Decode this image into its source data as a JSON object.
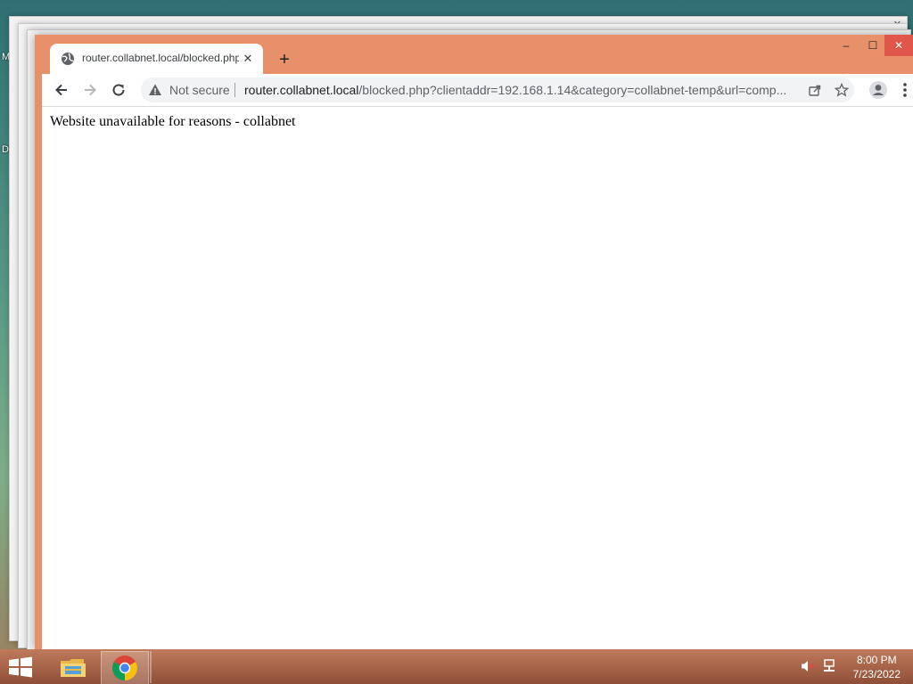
{
  "desktop": {
    "icon_labels": [
      "M",
      "D"
    ]
  },
  "browser": {
    "tab": {
      "title": "router.collabnet.local/blocked.php",
      "favicon": "globe-icon",
      "close_glyph": "✕"
    },
    "new_tab_glyph": "+",
    "window_controls": {
      "minimize": "–",
      "maximize": "☐",
      "close": "✕"
    },
    "toolbar": {
      "back_icon": "back-arrow-icon",
      "forward_icon": "forward-arrow-icon",
      "reload_icon": "reload-icon"
    },
    "omnibox": {
      "security_label": "Not secure",
      "url_host": "router.collabnet.local",
      "url_path": "/blocked.php?clientaddr=192.168.1.14&category=collabnet-temp&url=comp..."
    },
    "accent_color": "#e8906a",
    "close_color": "#e0564a"
  },
  "page": {
    "body_text": "Website unavailable for reasons - collabnet"
  },
  "taskbar": {
    "apps": [
      "file-explorer-icon",
      "chrome-icon"
    ],
    "clock": {
      "time": "8:00 PM",
      "date": "7/23/2022"
    }
  }
}
